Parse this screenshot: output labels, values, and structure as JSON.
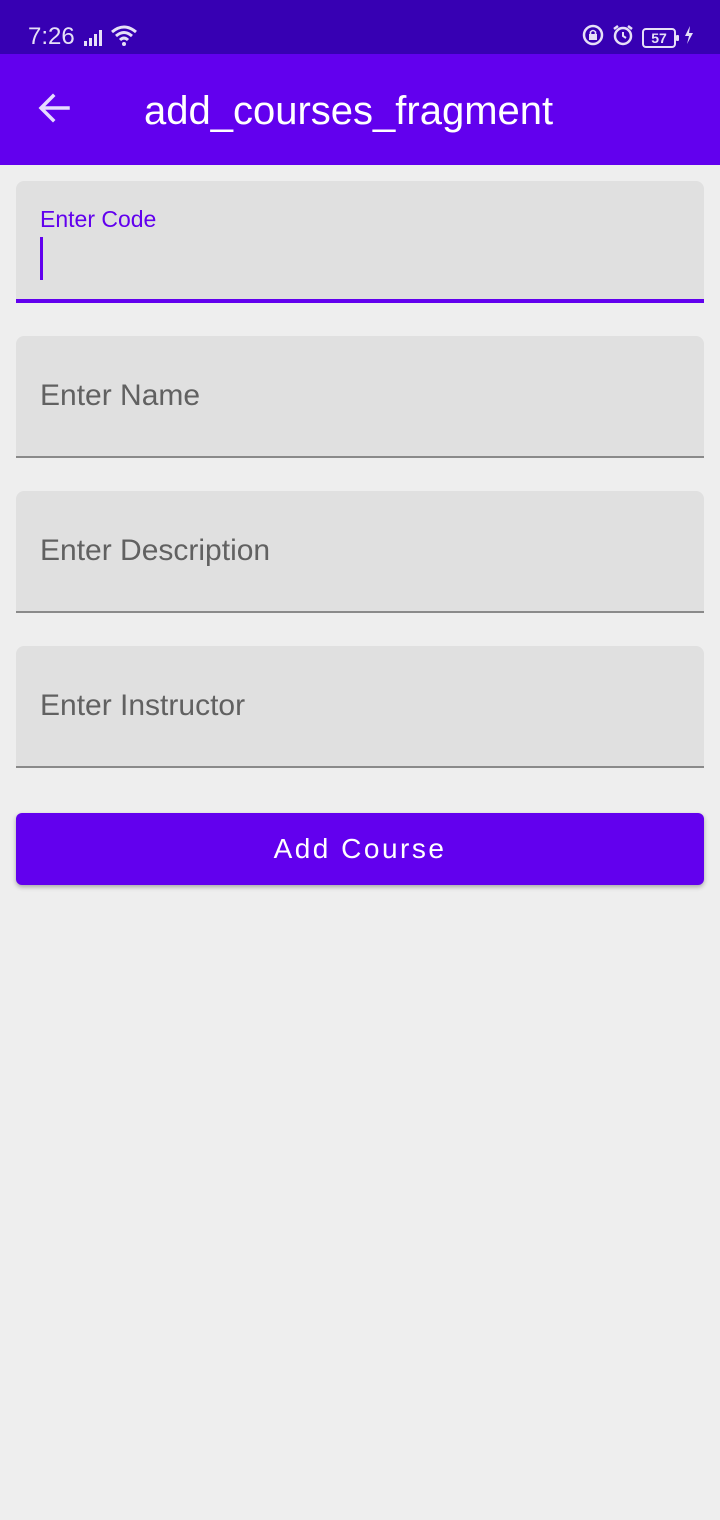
{
  "status_bar": {
    "time": "7:26",
    "battery": "57",
    "icons": [
      "signal-icon",
      "wifi-icon",
      "rotation-lock-icon",
      "alarm-icon",
      "battery-icon",
      "charging-icon"
    ]
  },
  "app_bar": {
    "title": "add_courses_fragment",
    "back_icon": "arrow-back-icon"
  },
  "form": {
    "code": {
      "label": "Enter Code",
      "value": ""
    },
    "name": {
      "placeholder": "Enter Name",
      "value": ""
    },
    "description": {
      "placeholder": "Enter Description",
      "value": ""
    },
    "instructor": {
      "placeholder": "Enter Instructor",
      "value": ""
    },
    "submit_label": "Add Course"
  },
  "colors": {
    "primary": "#6200ee",
    "primary_dark": "#3700b3",
    "field_bg": "#e0e0e0",
    "page_bg": "#eeeeee"
  }
}
